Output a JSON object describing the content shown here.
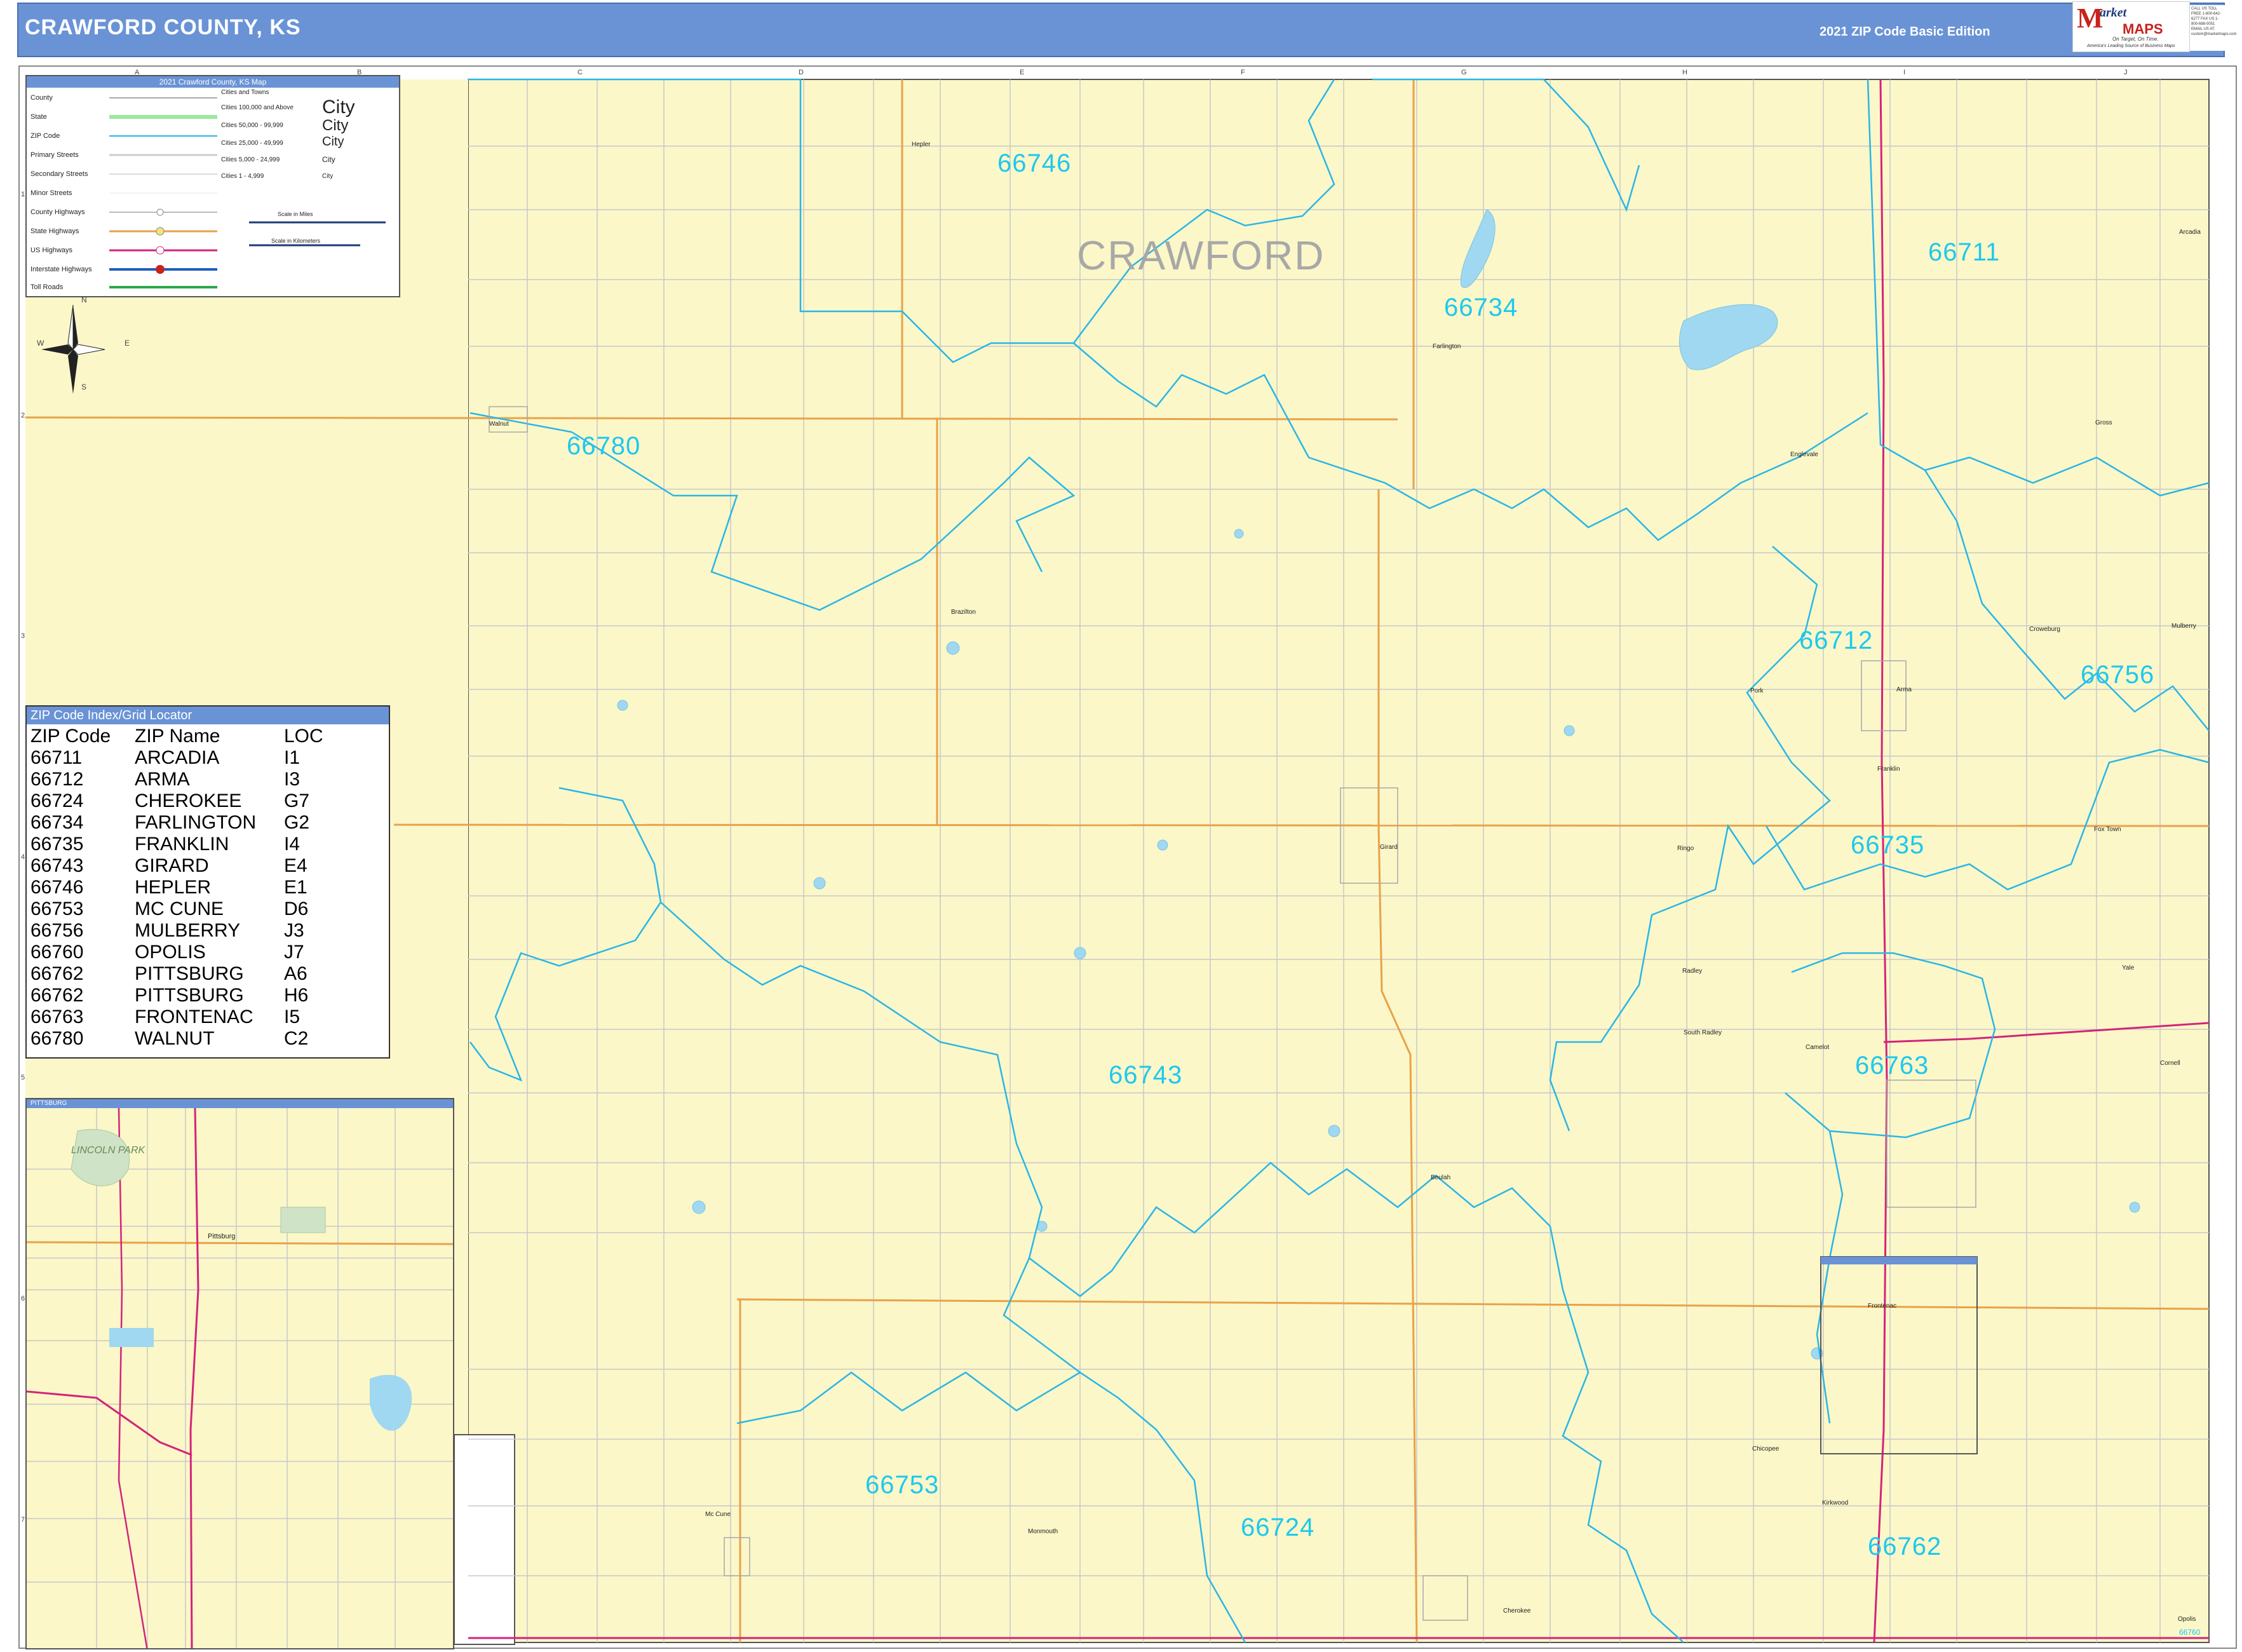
{
  "header": {
    "title": "CRAWFORD COUNTY, KS",
    "edition": "2021 ZIP Code Basic Edition"
  },
  "logo": {
    "m": "M",
    "arket": "arket",
    "maps": "MAPS",
    "tagline1": "On Target, On Time.",
    "tagline2": "America's Leading Source of Business Maps",
    "contact": "CALL US TOLL FREE 1-800-642-6277 FAX US 1-800-688-0051 EMAIL US AT: custom@marketmaps.com"
  },
  "grid": {
    "columns": [
      "A",
      "B",
      "C",
      "D",
      "E",
      "F",
      "G",
      "H",
      "I",
      "J"
    ],
    "rows": [
      "1",
      "2",
      "3",
      "4",
      "5",
      "6",
      "7"
    ]
  },
  "legend": {
    "title": "2021 Crawford County, KS Map",
    "cities_title": "Cities and Towns",
    "items": [
      "County",
      "State",
      "ZIP Code",
      "Primary Streets",
      "Secondary Streets",
      "Minor Streets",
      "County Highways",
      "State Highways",
      "US Highways",
      "Interstate Highways",
      "Toll Roads"
    ],
    "city_classes": [
      {
        "label": "Cities 100,000 and Above",
        "sample": "City"
      },
      {
        "label": "Cities 50,000 - 99,999",
        "sample": "City"
      },
      {
        "label": "Cities 25,000 - 49,999",
        "sample": "City"
      },
      {
        "label": "Cities 5,000 - 24,999",
        "sample": "City"
      },
      {
        "label": "Cities 1 - 4,999",
        "sample": "City"
      }
    ],
    "scale_miles": "Scale in Miles",
    "scale_km": "Scale in Kilometers"
  },
  "compass": {
    "n": "N",
    "s": "S",
    "e": "E",
    "w": "W"
  },
  "map": {
    "county_label": "CRAWFORD",
    "zip_labels": [
      {
        "code": "66746"
      },
      {
        "code": "66734"
      },
      {
        "code": "66711"
      },
      {
        "code": "66780"
      },
      {
        "code": "66712"
      },
      {
        "code": "66756"
      },
      {
        "code": "66735"
      },
      {
        "code": "66743"
      },
      {
        "code": "66763"
      },
      {
        "code": "66753"
      },
      {
        "code": "66724"
      },
      {
        "code": "66762"
      }
    ],
    "towns": [
      "Hepler",
      "Farlington",
      "Arcadia",
      "Walnut",
      "Englevale",
      "Brazilton",
      "Croweburg",
      "Mulberry",
      "Pork",
      "Arma",
      "Franklin",
      "Girard",
      "Ringo",
      "Fox Town",
      "Radley",
      "Yale",
      "South Radley",
      "Camelot",
      "Cornell",
      "Beulah",
      "Frontenac",
      "Chicopee",
      "Kirkwood",
      "Mc Cune",
      "Monmouth",
      "Cherokee",
      "Opolis",
      "Gross"
    ],
    "colors": {
      "land": "#fbf7c8",
      "zip_boundary": "#29b6e8",
      "state_hwy": "#e8a24a",
      "us_hwy": "#d4237a",
      "water": "#9fd8f0",
      "header": "#6a93d6"
    }
  },
  "zip_index": {
    "title": "ZIP Code Index/Grid Locator",
    "headers": [
      "ZIP Code",
      "ZIP Name",
      "LOC"
    ],
    "rows": [
      [
        "66711",
        "ARCADIA",
        "I1"
      ],
      [
        "66712",
        "ARMA",
        "I3"
      ],
      [
        "66724",
        "CHEROKEE",
        "G7"
      ],
      [
        "66734",
        "FARLINGTON",
        "G2"
      ],
      [
        "66735",
        "FRANKLIN",
        "I4"
      ],
      [
        "66743",
        "GIRARD",
        "E4"
      ],
      [
        "66746",
        "HEPLER",
        "E1"
      ],
      [
        "66753",
        "MC CUNE",
        "D6"
      ],
      [
        "66756",
        "MULBERRY",
        "J3"
      ],
      [
        "66760",
        "OPOLIS",
        "J7"
      ],
      [
        "66762",
        "PITTSBURG",
        "A6"
      ],
      [
        "66762",
        "PITTSBURG",
        "H6"
      ],
      [
        "66763",
        "FRONTENAC",
        "I5"
      ],
      [
        "66780",
        "WALNUT",
        "C2"
      ]
    ]
  },
  "inset": {
    "title": "PITTSBURG",
    "park": "LINCOLN PARK",
    "city": "Pittsburg",
    "frame_title": "PITTSBURG"
  },
  "corner_zip": "66760"
}
